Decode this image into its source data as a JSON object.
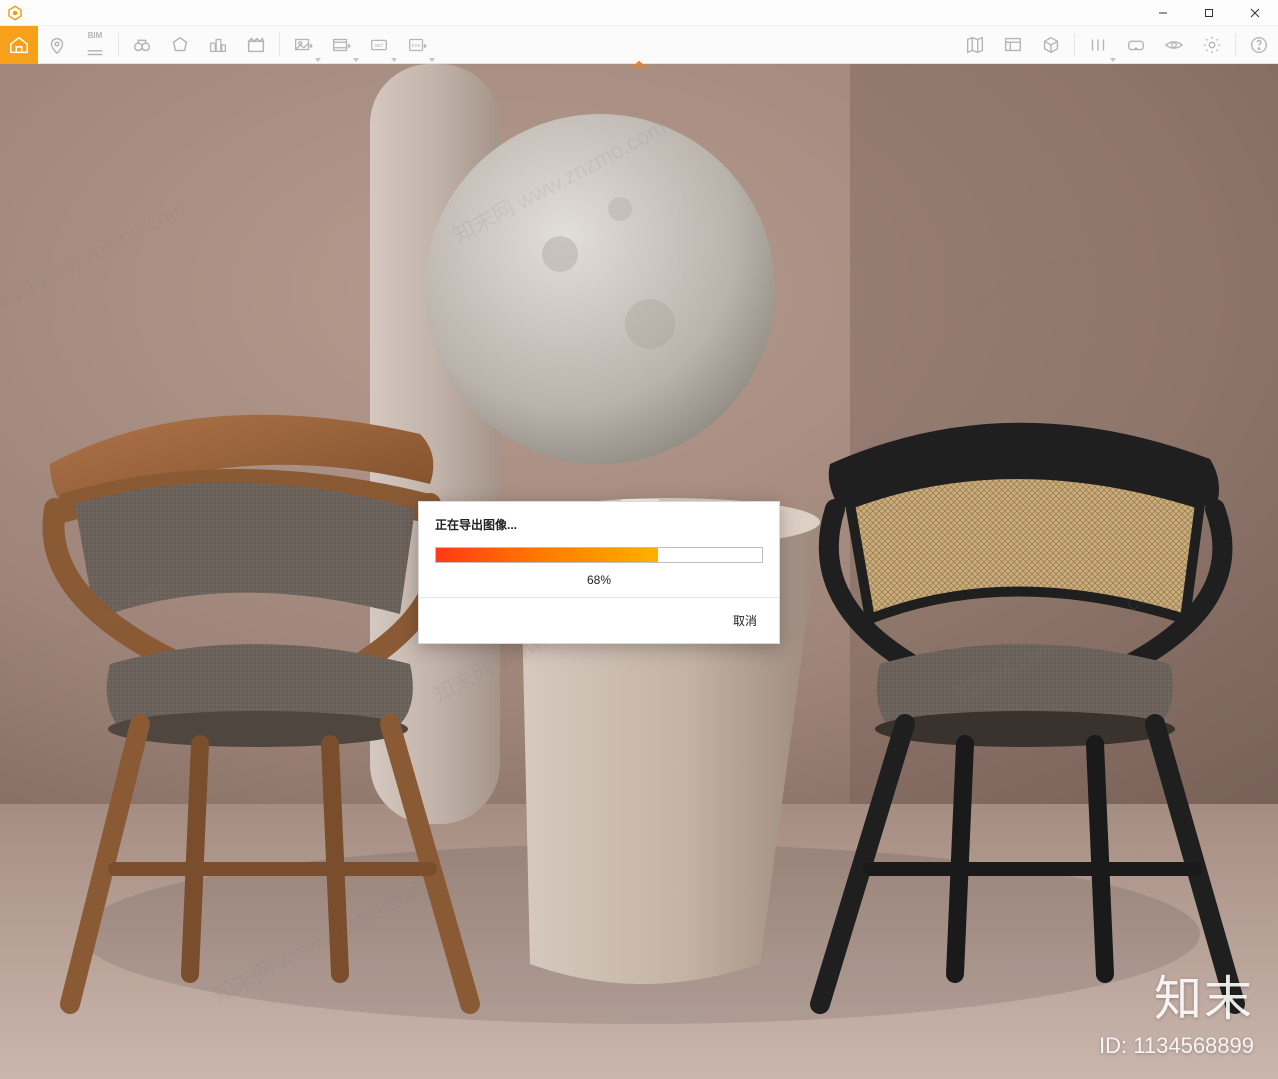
{
  "window": {
    "minimize_tooltip": "Minimize",
    "maximize_tooltip": "Maximize",
    "close_tooltip": "Close"
  },
  "toolbar": {
    "left": [
      {
        "name": "home-icon",
        "label": "Home",
        "active": true
      },
      {
        "name": "pin-icon",
        "label": "Location"
      },
      {
        "name": "bim-icon",
        "label": "BIM"
      },
      {
        "name": "binoculars-icon",
        "label": "View"
      },
      {
        "name": "prism-icon",
        "label": "Scene"
      },
      {
        "name": "buildings-icon",
        "label": "Buildings"
      },
      {
        "name": "clapper-icon",
        "label": "Animation"
      },
      {
        "name": "export-image-icon",
        "label": "Export Image",
        "hasDropdown": true
      },
      {
        "name": "export-video-icon",
        "label": "Export Video",
        "hasDropdown": true
      },
      {
        "name": "panorama-360-icon",
        "label": "360",
        "hasDropdown": true
      },
      {
        "name": "export-exe-icon",
        "label": "Export EXE",
        "hasDropdown": true
      }
    ],
    "right": [
      {
        "name": "map-icon",
        "label": "Map"
      },
      {
        "name": "grid-icon",
        "label": "Layout"
      },
      {
        "name": "cube-icon",
        "label": "3D"
      },
      {
        "name": "split-icon",
        "label": "Split",
        "hasDropdown": true
      },
      {
        "name": "vr-icon",
        "label": "VR"
      },
      {
        "name": "eye-icon",
        "label": "Visibility"
      },
      {
        "name": "gear-icon",
        "label": "Settings"
      },
      {
        "name": "help-icon",
        "label": "Help"
      }
    ]
  },
  "dialog": {
    "title": "正在导出图像...",
    "percent": 68,
    "percent_label": "68%",
    "cancel": "取消"
  },
  "watermark": {
    "brand": "知末",
    "id_label": "ID: 1134568899",
    "diagonal": "知末网 www.znzmo.com"
  }
}
